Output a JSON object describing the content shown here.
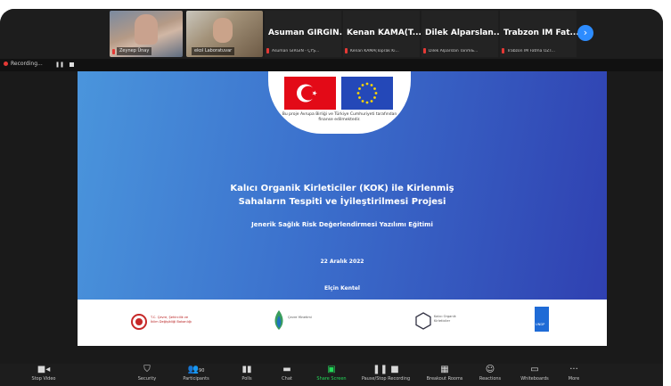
{
  "participants": {
    "video_tiles": [
      {
        "name": "Zeynep Ünay"
      },
      {
        "name": "ekol Laboratuvar"
      }
    ],
    "name_tiles": [
      {
        "display": "Asuman GİRGİN...",
        "full": "Asuman GİRGİN - ÇYŞ..."
      },
      {
        "display": "Kenan KAMA(T...",
        "full": "Kenan KAMA(Toprak Ki..."
      },
      {
        "display": "Dilek Alparslan...",
        "full": "Dilek Alparslan Tarım&..."
      },
      {
        "display": "Trabzon İM Fat...",
        "full": "Trabzon İM Fatma ÖZT..."
      }
    ],
    "next_icon": "chevron-right-icon"
  },
  "recording": {
    "status": "Recording..."
  },
  "slide": {
    "flag_caption": "Bu proje Avrupa Birliği ve Türkiye Cumhuriyeti tarafından finanse edilmektedir.",
    "title_line1": "Kalıcı Organik Kirleticiler (KOK) ile Kirlenmiş",
    "title_line2": "Sahaların Tespiti ve İyileştirilmesi Projesi",
    "subtitle": "Jenerik Sağlık Risk Değerlendirmesi Yazılımı Eğitimi",
    "date": "22 Aralık 2022",
    "author": "Elçin Kentel",
    "footer_logos": [
      "T.C. Çevre, Şehircilik ve İklim Değişikliği Bakanlığı",
      "Çevre Yönetimi",
      "Kalıcı Organik Kirleticiler",
      "UNDP"
    ]
  },
  "toolbar": {
    "stop_video": "Stop Video",
    "security": "Security",
    "participants": "Participants",
    "participants_count": "90",
    "polls": "Polls",
    "chat": "Chat",
    "share_screen": "Share Screen",
    "pause_stop_recording": "Pause/Stop Recording",
    "breakout_rooms": "Breakout Rooms",
    "reactions": "Reactions",
    "whiteboards": "Whiteboards",
    "more": "More"
  },
  "colors": {
    "share_green": "#23d959",
    "accent_blue": "#2d8cff",
    "mic_red": "#e53935"
  }
}
